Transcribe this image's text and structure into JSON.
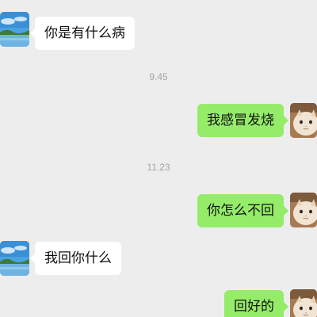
{
  "messages": [
    {
      "side": "in",
      "text": "你是有什么病"
    },
    {
      "side": "time",
      "text": "9.45"
    },
    {
      "side": "out",
      "text": "我感冒发烧"
    },
    {
      "side": "time",
      "text": "11.23"
    },
    {
      "side": "out",
      "text": "你怎么不回"
    },
    {
      "side": "in",
      "text": "我回你什么"
    },
    {
      "side": "out",
      "text": "回好的"
    }
  ],
  "avatars": {
    "contact": "landscape-avatar-icon",
    "self": "cat-avatar-icon"
  },
  "colors": {
    "background": "#ededed",
    "incoming_bubble": "#ffffff",
    "outgoing_bubble": "#95ec69",
    "timestamp": "#a4a4a4"
  }
}
